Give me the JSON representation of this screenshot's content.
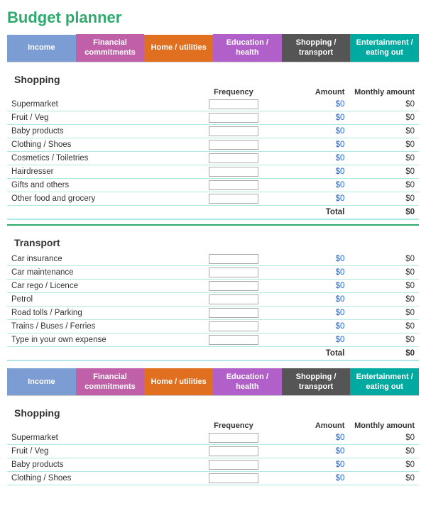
{
  "title": "Budget planner",
  "tabs": [
    {
      "id": "income",
      "label": "Income",
      "class": "tab-income"
    },
    {
      "id": "financial",
      "label": "Financial commitments",
      "class": "tab-financial"
    },
    {
      "id": "home",
      "label": "Home / utilities",
      "class": "tab-home"
    },
    {
      "id": "education",
      "label": "Education / health",
      "class": "tab-education"
    },
    {
      "id": "shopping",
      "label": "Shopping / transport",
      "class": "tab-shopping"
    },
    {
      "id": "entertainment",
      "label": "Entertainment / eating out",
      "class": "tab-entertainment"
    }
  ],
  "section1": {
    "title": "Shopping",
    "headers": {
      "frequency": "Frequency",
      "amount": "Amount",
      "monthly": "Monthly amount"
    },
    "rows": [
      {
        "label": "Supermarket",
        "amount": "$0",
        "monthly": "$0"
      },
      {
        "label": "Fruit / Veg",
        "amount": "$0",
        "monthly": "$0"
      },
      {
        "label": "Baby products",
        "amount": "$0",
        "monthly": "$0"
      },
      {
        "label": "Clothing / Shoes",
        "amount": "$0",
        "monthly": "$0"
      },
      {
        "label": "Cosmetics / Toiletries",
        "amount": "$0",
        "monthly": "$0"
      },
      {
        "label": "Hairdresser",
        "amount": "$0",
        "monthly": "$0"
      },
      {
        "label": "Gifts and others",
        "amount": "$0",
        "monthly": "$0"
      },
      {
        "label": "Other food and grocery",
        "amount": "$0",
        "monthly": "$0"
      }
    ],
    "total": {
      "label": "Total",
      "monthly": "$0"
    }
  },
  "section2": {
    "title": "Transport",
    "rows": [
      {
        "label": "Car insurance",
        "amount": "$0",
        "monthly": "$0"
      },
      {
        "label": "Car maintenance",
        "amount": "$0",
        "monthly": "$0"
      },
      {
        "label": "Car rego / Licence",
        "amount": "$0",
        "monthly": "$0"
      },
      {
        "label": "Petrol",
        "amount": "$0",
        "monthly": "$0"
      },
      {
        "label": "Road tolls / Parking",
        "amount": "$0",
        "monthly": "$0"
      },
      {
        "label": "Trains / Buses / Ferries",
        "amount": "$0",
        "monthly": "$0"
      },
      {
        "label": "Type in your own expense",
        "amount": "$0",
        "monthly": "$0"
      }
    ],
    "total": {
      "label": "Total",
      "monthly": "$0"
    }
  },
  "section3": {
    "title": "Shopping",
    "headers": {
      "frequency": "Frequency",
      "amount": "Amount",
      "monthly": "Monthly amount"
    },
    "rows": [
      {
        "label": "Supermarket",
        "amount": "$0",
        "monthly": "$0"
      },
      {
        "label": "Fruit / Veg",
        "amount": "$0",
        "monthly": "$0"
      },
      {
        "label": "Baby products",
        "amount": "$0",
        "monthly": "$0"
      },
      {
        "label": "Clothing / Shoes",
        "amount": "$0",
        "monthly": "$0"
      }
    ]
  }
}
